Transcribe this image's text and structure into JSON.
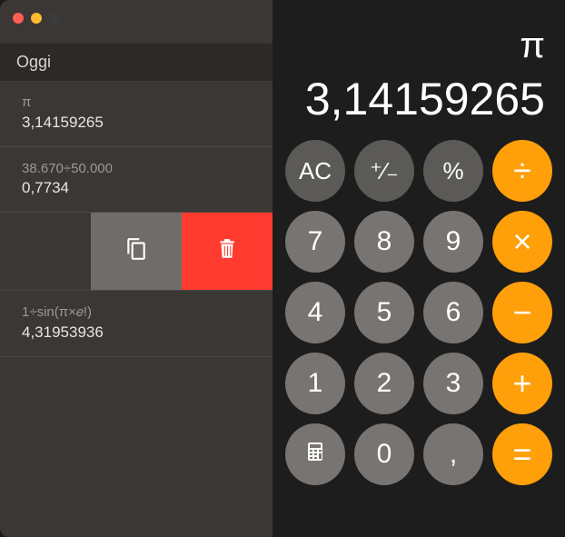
{
  "traffic": {
    "close": "close",
    "minimize": "minimize",
    "maximize": "maximize"
  },
  "history": {
    "header": "Oggi",
    "items": [
      {
        "expr": "π",
        "result": "3,14159265"
      },
      {
        "expr": "38.670÷50.000",
        "result": "0,7734"
      },
      {
        "expr": "1÷sin(π×𝑒!)",
        "result": "4,31953936"
      }
    ],
    "swipe": {
      "copy": "copy",
      "delete": "delete"
    }
  },
  "display": {
    "symbol": "π",
    "value": "3,14159265"
  },
  "keys": {
    "ac": "AC",
    "sign": "⁺∕₋",
    "percent": "%",
    "divide": "÷",
    "k7": "7",
    "k8": "8",
    "k9": "9",
    "multiply": "×",
    "k4": "4",
    "k5": "5",
    "k6": "6",
    "minus": "−",
    "k1": "1",
    "k2": "2",
    "k3": "3",
    "plus": "+",
    "k0": "0",
    "decimal": ",",
    "equals": "="
  }
}
